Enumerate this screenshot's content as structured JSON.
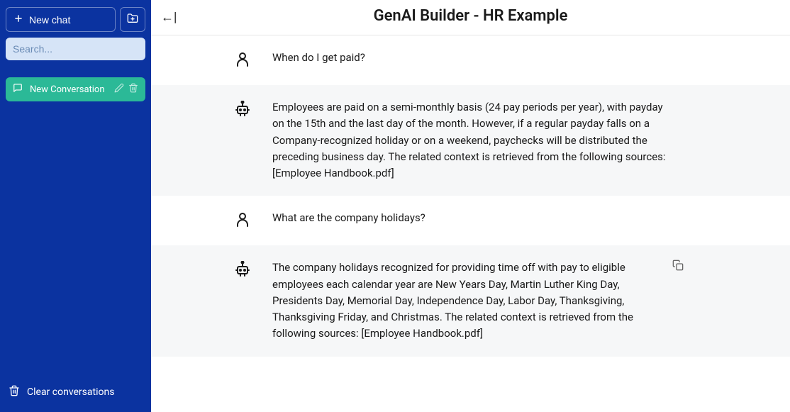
{
  "sidebar": {
    "newChatLabel": "New chat",
    "searchPlaceholder": "Search...",
    "conversations": [
      {
        "title": "New Conversation"
      }
    ],
    "clearLabel": "Clear conversations"
  },
  "header": {
    "title": "GenAI Builder - HR Example"
  },
  "messages": [
    {
      "role": "user",
      "text": "When do I get paid?"
    },
    {
      "role": "bot",
      "text": "Employees are paid on a semi-monthly basis (24 pay periods per year), with payday on the 15th and the last day of the month. However, if a regular payday falls on a Company-recognized holiday or on a weekend, paychecks will be distributed the preceding business day. The related context is retrieved from the following sources: [Employee Handbook.pdf]"
    },
    {
      "role": "user",
      "text": "What are the company holidays?"
    },
    {
      "role": "bot",
      "text": "The company holidays recognized for providing time off with pay to eligible employees each calendar year are New Years Day, Martin Luther King Day, Presidents Day, Memorial Day, Independence Day, Labor Day, Thanksgiving, Thanksgiving Friday, and Christmas. The related context is retrieved from the following sources: [Employee Handbook.pdf]",
      "showCopy": true
    }
  ]
}
